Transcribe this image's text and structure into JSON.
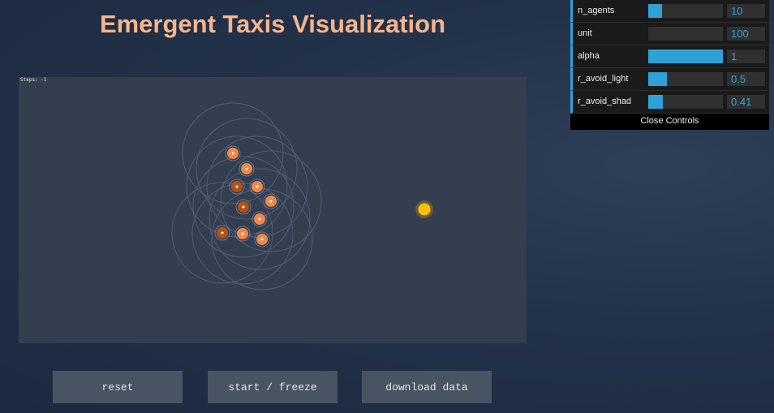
{
  "page": {
    "title": "Emergent Taxis Visualization"
  },
  "canvas": {
    "steps_text": "Steps: -1"
  },
  "buttons": {
    "reset": "reset",
    "start_freeze": "start / freeze",
    "download": "download data"
  },
  "controls": {
    "items": [
      {
        "label": "n_agents",
        "value": "10",
        "fill": 0.18
      },
      {
        "label": "unit",
        "value": "100",
        "fill": 0
      },
      {
        "label": "alpha",
        "value": "1",
        "fill": 1
      },
      {
        "label": "r_avoid_light",
        "value": "0.5",
        "fill": 0.25
      },
      {
        "label": "r_avoid_shad",
        "value": "0.41",
        "fill": 0.2
      }
    ],
    "close_label": "Close Controls"
  },
  "colors": {
    "accent": "#2fa1d6",
    "title": "#f5b48a",
    "light": "#ffc107",
    "agent_light": "#f0884a",
    "agent_dark": "#b35214"
  }
}
